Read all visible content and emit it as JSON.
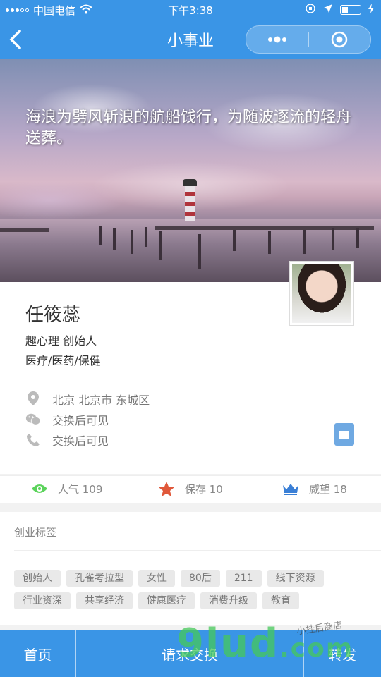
{
  "status_bar": {
    "carrier": "中国电信",
    "time": "下午3:38"
  },
  "nav": {
    "title": "小事业"
  },
  "banner": {
    "quote": "海浪为劈风斩浪的航船饯行，为随波逐流的轻舟送葬。"
  },
  "profile": {
    "name": "任筱蕊",
    "role": "趣心理 创始人",
    "industry": "医疗/医药/保健",
    "location": "北京 北京市 东城区",
    "wechat": "交换后可见",
    "phone": "交换后可见"
  },
  "stats": {
    "popularity": "人气 109",
    "saved": "保存 10",
    "prestige": "威望 18"
  },
  "tags_section": {
    "title": "创业标签",
    "tags": [
      "创始人",
      "孔雀考拉型",
      "女性",
      "80后",
      "211",
      "线下资源",
      "行业资深",
      "共享经济",
      "健康医疗",
      "消费升级",
      "教育"
    ]
  },
  "tabbar": {
    "home": "首页",
    "exchange": "请求交换",
    "share": "转发"
  },
  "watermark": {
    "main": "9lud",
    "suffix": ".com",
    "small": "小挂后商店"
  },
  "colors": {
    "primary": "#3a95e6",
    "eye": "#5bd35b",
    "star": "#e0583a",
    "crown": "#3a7fd6"
  }
}
